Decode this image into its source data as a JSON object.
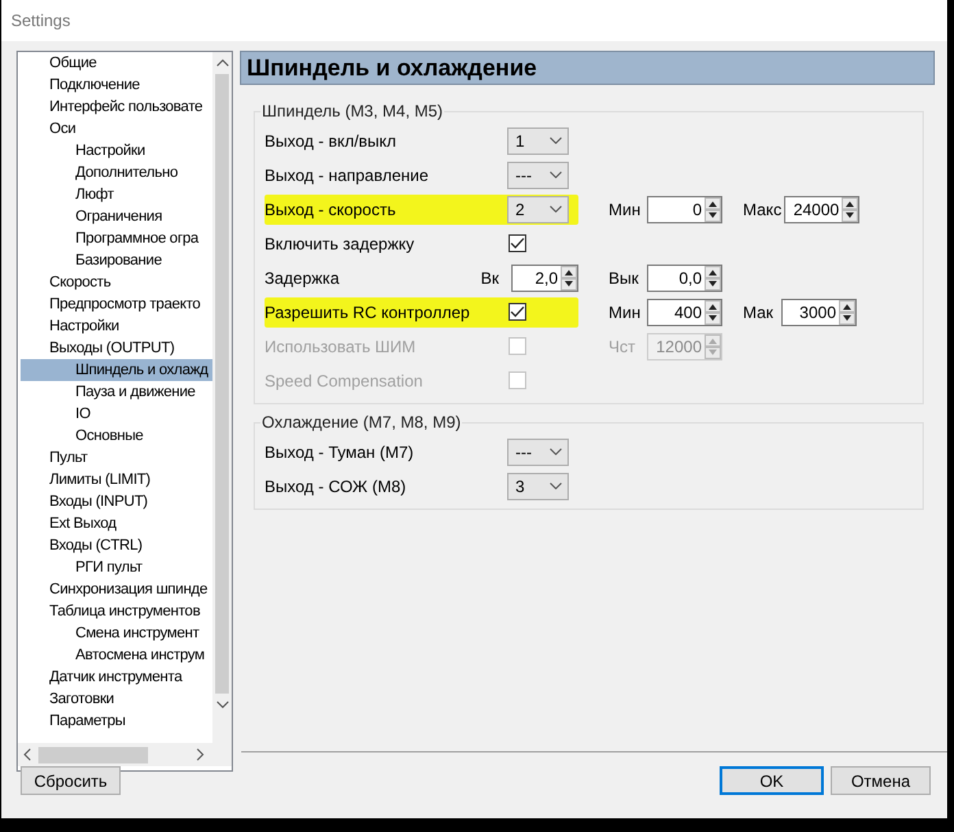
{
  "window": {
    "title": "Settings"
  },
  "tree": {
    "items": [
      {
        "label": "Общие",
        "selected": false
      },
      {
        "label": "Подключение",
        "selected": false
      },
      {
        "label": "Интерфейс пользовате",
        "selected": false
      },
      {
        "label": "Оси",
        "selected": false,
        "children": [
          {
            "label": "Настройки",
            "selected": false
          },
          {
            "label": "Дополнительно",
            "selected": false
          },
          {
            "label": "Люфт",
            "selected": false
          },
          {
            "label": "Ограничения",
            "selected": false
          },
          {
            "label": "Программное огра",
            "selected": false
          },
          {
            "label": "Базирование",
            "selected": false
          }
        ]
      },
      {
        "label": "Скорость",
        "selected": false
      },
      {
        "label": "Предпросмотр траекто",
        "selected": false
      },
      {
        "label": "Настройки",
        "selected": false
      },
      {
        "label": "Выходы (OUTPUT)",
        "selected": false,
        "children": [
          {
            "label": "Шпиндель и охлажд",
            "selected": true
          },
          {
            "label": "Пауза и движение",
            "selected": false
          },
          {
            "label": "IO",
            "selected": false
          },
          {
            "label": "Основные",
            "selected": false
          }
        ]
      },
      {
        "label": "Пульт",
        "selected": false
      },
      {
        "label": "Лимиты (LIMIT)",
        "selected": false
      },
      {
        "label": "Входы (INPUT)",
        "selected": false
      },
      {
        "label": "Ext Выход",
        "selected": false
      },
      {
        "label": "Входы (CTRL)",
        "selected": false,
        "children": [
          {
            "label": "РГИ пульт",
            "selected": false
          }
        ]
      },
      {
        "label": "Синхронизация шпинде",
        "selected": false
      },
      {
        "label": "Таблица инструментов",
        "selected": false,
        "children": [
          {
            "label": "Смена инструмент",
            "selected": false
          },
          {
            "label": "Автосмена инструм",
            "selected": false
          }
        ]
      },
      {
        "label": "Датчик инструмента",
        "selected": false
      },
      {
        "label": "Заготовки",
        "selected": false
      },
      {
        "label": "Параметры",
        "selected": false
      }
    ]
  },
  "panel": {
    "title": "Шпиндель и охлаждение"
  },
  "groups": [
    {
      "title": "Шпиндель (M3, M4, M5)",
      "rows": [
        {
          "kind": "combo",
          "label": "Выход - вкл/выкл",
          "value": "1",
          "highlighted": false,
          "disabled": false
        },
        {
          "kind": "combo",
          "label": "Выход - направление",
          "value": "---",
          "highlighted": false,
          "disabled": false
        },
        {
          "kind": "combo",
          "label": "Выход - скорость",
          "value": "2",
          "highlighted": true,
          "disabled": false,
          "side": [
            {
              "label": "Мин",
              "value": "0",
              "disabled": false
            },
            {
              "label": "Макс",
              "value": "24000",
              "disabled": false
            }
          ]
        },
        {
          "kind": "check",
          "label": "Включить задержку",
          "checked": true,
          "highlighted": false,
          "disabled": false
        },
        {
          "kind": "spin",
          "label": "Задержка",
          "spin": {
            "label": "Вк",
            "value": "2,0"
          },
          "highlighted": false,
          "disabled": false,
          "side": [
            {
              "label": "Вык",
              "value": "0,0",
              "disabled": false
            }
          ]
        },
        {
          "kind": "check",
          "label": "Разрешить RC контроллер",
          "checked": true,
          "highlighted": true,
          "disabled": false,
          "side": [
            {
              "label": "Мин",
              "value": "400",
              "disabled": false
            },
            {
              "label": "Мак",
              "value": "3000",
              "disabled": false
            }
          ]
        },
        {
          "kind": "check",
          "label": "Использовать ШИМ",
          "checked": false,
          "highlighted": false,
          "disabled": true,
          "side": [
            {
              "label": "Чст",
              "value": "12000",
              "disabled": true
            }
          ]
        },
        {
          "kind": "check",
          "label": "Speed Compensation",
          "checked": false,
          "highlighted": false,
          "disabled": true
        }
      ]
    },
    {
      "title": "Охлаждение (M7, M8, M9)",
      "rows": [
        {
          "kind": "combo",
          "label": "Выход - Туман (M7)",
          "value": "---",
          "highlighted": false,
          "disabled": false
        },
        {
          "kind": "combo",
          "label": "Выход - СОЖ (M8)",
          "value": "3",
          "highlighted": false,
          "disabled": false
        }
      ]
    }
  ],
  "buttons": [
    {
      "label": "Сбросить",
      "kind": "reset",
      "default": false
    },
    {
      "label": "OK",
      "kind": "ok",
      "default": true
    },
    {
      "label": "Отмена",
      "kind": "cancel",
      "default": false
    }
  ]
}
